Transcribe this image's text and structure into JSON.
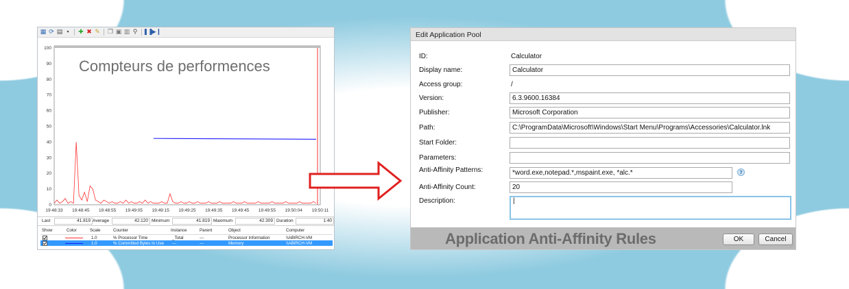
{
  "perfmon": {
    "title": "Compteurs de performences",
    "toolbar_icons": [
      "view-graph-icon",
      "refresh-icon",
      "change-graph-type-icon",
      "add-counter-icon",
      "delete-counter-icon",
      "highlight-icon",
      "copy-icon",
      "paste-icon",
      "properties-icon",
      "zoom-icon",
      "freeze-icon",
      "update-data-icon"
    ],
    "stats": {
      "last_label": "Last",
      "last_value": "41.819",
      "average_label": "Average",
      "average_value": "42.120",
      "minimum_label": "Minimum",
      "minimum_value": "41.819",
      "maximum_label": "Maximum",
      "maximum_value": "42.309",
      "duration_label": "Duration",
      "duration_value": "1:40"
    },
    "table": {
      "headers": [
        "Show",
        "Color",
        "Scale",
        "Counter",
        "Instance",
        "Parent",
        "Object",
        "Computer"
      ],
      "rows": [
        {
          "color": "#ff3030",
          "scale": "1.0",
          "counter": "% Processor Time",
          "instance": "_Total",
          "parent": "---",
          "object": "Processor Information",
          "computer": "\\\\ABIRCH-VM"
        },
        {
          "color": "#1a1aff",
          "scale": "1.0",
          "counter": "% Committed Bytes In Use",
          "instance": "---",
          "parent": "---",
          "object": "Memory",
          "computer": "\\\\ABIRCH-VM"
        }
      ]
    }
  },
  "chart_data": {
    "type": "line",
    "title": "Compteurs de performences",
    "xlabel": "",
    "ylabel": "",
    "ylim": [
      0,
      100
    ],
    "yticks": [
      "100",
      "90",
      "80",
      "70",
      "60",
      "50",
      "40",
      "30",
      "20",
      "10",
      "0"
    ],
    "xticks": [
      "19:48:33",
      "19:48:45",
      "19:48:55",
      "19:49:05",
      "19:49:15",
      "19:49:25",
      "19:49:35",
      "19:49:45",
      "19:49:55",
      "19:50:04",
      "19:50:11"
    ],
    "grid": false,
    "series": [
      {
        "name": "% Processor Time",
        "color": "#ff3030",
        "t": [
          0,
          1,
          2,
          3,
          4,
          5,
          6,
          7,
          8,
          9,
          10,
          11,
          12,
          13,
          14,
          15,
          16,
          17,
          18,
          19,
          20,
          21,
          22,
          23,
          24,
          25,
          26,
          27,
          28,
          29,
          30,
          31,
          32,
          33,
          34,
          35,
          36,
          37,
          38,
          39,
          40,
          41,
          42,
          43,
          44,
          45,
          46,
          47,
          48,
          49,
          50,
          51,
          52,
          53,
          54,
          55,
          56,
          57,
          58,
          59,
          60,
          61,
          62,
          63,
          64,
          65,
          66,
          67,
          68,
          69,
          70,
          71,
          72,
          73,
          74,
          75,
          76,
          77,
          78,
          79,
          80,
          81,
          82,
          83,
          84,
          85,
          86,
          87,
          88,
          89,
          90,
          91,
          92,
          93,
          94,
          95
        ],
        "values": [
          1,
          3,
          1,
          2,
          4,
          1,
          2,
          1,
          40,
          6,
          3,
          8,
          2,
          12,
          10,
          3,
          2,
          1,
          3,
          2,
          1,
          2,
          1,
          1,
          2,
          1,
          3,
          1,
          2,
          1,
          1,
          2,
          1,
          3,
          1,
          2,
          1,
          1,
          1,
          2,
          1,
          1,
          7,
          2,
          1,
          1,
          2,
          1,
          1,
          2,
          1,
          1,
          2,
          1,
          1,
          1,
          2,
          1,
          1,
          1,
          2,
          1,
          1,
          1,
          1,
          2,
          1,
          1,
          1,
          2,
          1,
          1,
          1,
          1,
          2,
          1,
          1,
          1,
          1,
          2,
          1,
          1,
          1,
          1,
          2,
          1,
          1,
          1,
          1,
          2,
          1,
          1,
          1,
          1,
          2,
          1
        ]
      },
      {
        "name": "% Committed Bytes In Use",
        "color": "#1a1aff",
        "t": [
          36,
          95
        ],
        "values": [
          42.3,
          41.8
        ]
      }
    ]
  },
  "dialog": {
    "title": "Edit Application Pool",
    "fields": {
      "id_label": "ID:",
      "id_value": "Calculator",
      "display_name_label": "Display name:",
      "display_name_value": "Calculator",
      "access_group_label": "Access group:",
      "access_group_value": "/",
      "version_label": "Version:",
      "version_value": "6.3.9600.16384",
      "publisher_label": "Publisher:",
      "publisher_value": "Microsoft Corporation",
      "path_label": "Path:",
      "path_value": "C:\\ProgramData\\Microsoft\\Windows\\Start Menu\\Programs\\Accessories\\Calculator.lnk",
      "start_folder_label": "Start Folder:",
      "start_folder_value": "",
      "parameters_label": "Parameters:",
      "parameters_value": "",
      "patterns_label": "Anti-Affinity Patterns:",
      "patterns_value": "*word.exe,notepad.*,mspaint.exe, *alc.*",
      "count_label": "Anti-Affinity Count:",
      "count_value": "20",
      "description_label": "Description:",
      "description_value": "|"
    },
    "help_glyph": "?",
    "footer_caption": "Application Anti-Affinity Rules",
    "ok_label": "OK",
    "cancel_label": "Cancel"
  },
  "colors": {
    "frame": "#8fcbe0",
    "arrow": "#e02020",
    "footer": "#b9b9b9"
  }
}
